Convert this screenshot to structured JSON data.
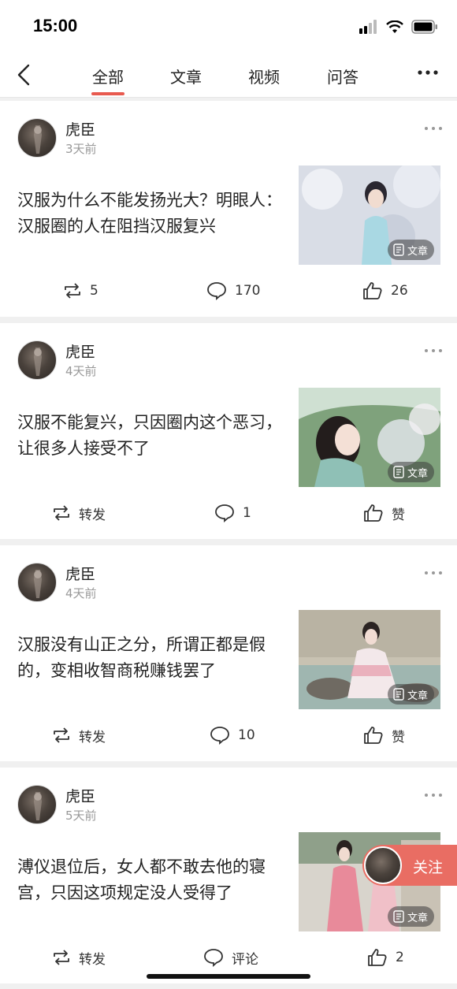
{
  "status_bar": {
    "time": "15:00"
  },
  "nav": {
    "tabs": [
      {
        "label": "全部",
        "active": true
      },
      {
        "label": "文章",
        "active": false
      },
      {
        "label": "视频",
        "active": false
      },
      {
        "label": "问答",
        "active": false
      }
    ]
  },
  "accent_color": "#e85a4f",
  "feed": [
    {
      "author": "虎臣",
      "time": "3天前",
      "title": "汉服为什么不能发扬光大？明眼人：汉服圈的人在阻挡汉服复兴",
      "badge": "文章",
      "repost": "5",
      "comments": "170",
      "likes": "26"
    },
    {
      "author": "虎臣",
      "time": "4天前",
      "title": "汉服不能复兴，只因圈内这个恶习，让很多人接受不了",
      "badge": "文章",
      "repost": "转发",
      "comments": "1",
      "likes": "赞"
    },
    {
      "author": "虎臣",
      "time": "4天前",
      "title": "汉服没有山正之分，所谓正都是假的，变相收智商税赚钱罢了",
      "badge": "文章",
      "repost": "转发",
      "comments": "10",
      "likes": "赞"
    },
    {
      "author": "虎臣",
      "time": "5天前",
      "title": "溥仪退位后，女人都不敢去他的寝宫，只因这项规定没人受得了",
      "badge": "文章",
      "repost": "转发",
      "comments": "评论",
      "likes": "2"
    }
  ],
  "follow_button": {
    "label": "关注"
  }
}
